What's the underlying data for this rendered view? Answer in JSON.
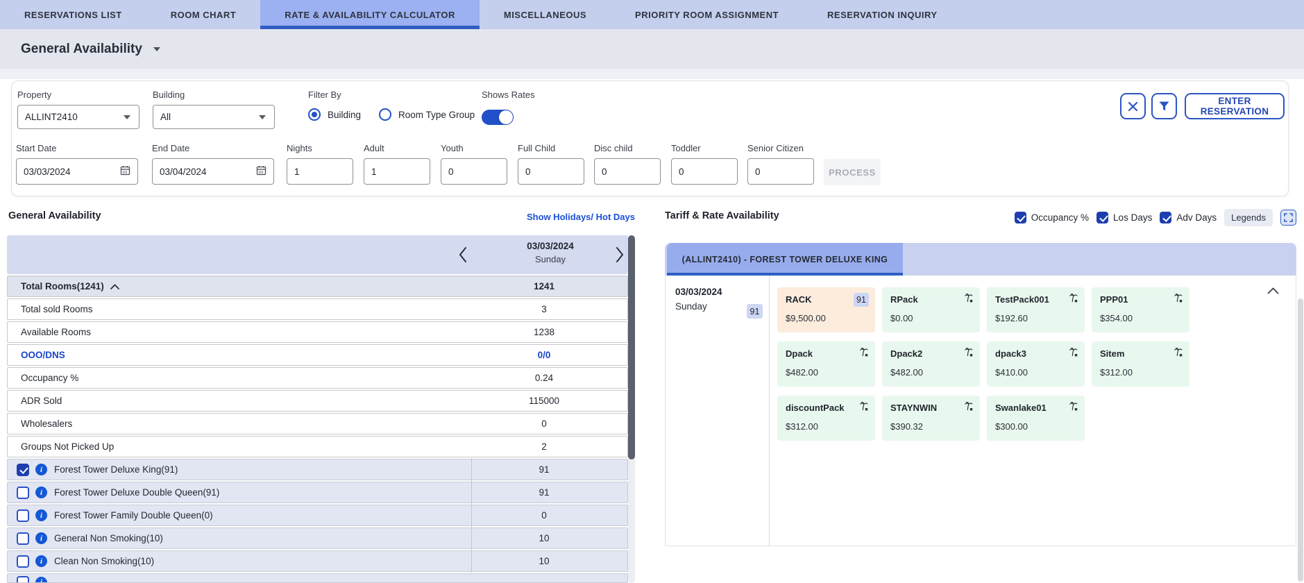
{
  "nav": {
    "tabs": [
      {
        "label": "RESERVATIONS LIST",
        "active": false
      },
      {
        "label": "ROOM CHART",
        "active": false
      },
      {
        "label": "RATE & AVAILABILITY CALCULATOR",
        "active": true
      },
      {
        "label": "MISCELLANEOUS",
        "active": false
      },
      {
        "label": "PRIORITY ROOM ASSIGNMENT",
        "active": false
      },
      {
        "label": "RESERVATION INQUIRY",
        "active": false
      }
    ]
  },
  "page": {
    "title": "General Availability"
  },
  "filters": {
    "property": {
      "label": "Property",
      "value": "ALLINT2410"
    },
    "building": {
      "label": "Building",
      "value": "All"
    },
    "filter_by": {
      "label": "Filter By",
      "options": [
        {
          "label": "Building",
          "selected": true
        },
        {
          "label": "Room Type Group",
          "selected": false
        }
      ]
    },
    "shows_rates": {
      "label": "Shows Rates",
      "on": true
    },
    "start_date": {
      "label": "Start Date",
      "value": "03/03/2024"
    },
    "end_date": {
      "label": "End Date",
      "value": "03/04/2024"
    },
    "nights": {
      "label": "Nights",
      "value": "1"
    },
    "adult": {
      "label": "Adult",
      "value": "1"
    },
    "youth": {
      "label": "Youth",
      "value": "0"
    },
    "full_child": {
      "label": "Full Child",
      "value": "0"
    },
    "disc_child": {
      "label": "Disc child",
      "value": "0"
    },
    "toddler": {
      "label": "Toddler",
      "value": "0"
    },
    "senior_citizen": {
      "label": "Senior Citizen",
      "value": "0"
    }
  },
  "actions": {
    "process": "PROCESS",
    "enter_reservation": "ENTER RESERVATION"
  },
  "general_availability": {
    "title": "General Availability",
    "holidays_link": "Show Holidays/ Hot Days",
    "date_nav": {
      "date": "03/03/2024",
      "day": "Sunday"
    },
    "metrics": [
      {
        "label": "Total Rooms(1241)",
        "value": "1241",
        "header_row": true
      },
      {
        "label": "Total sold Rooms",
        "value": "3"
      },
      {
        "label": "Available Rooms",
        "value": "1238"
      },
      {
        "label": "OOO/DNS",
        "value": "0/0",
        "accent": true
      },
      {
        "label": "Occupancy %",
        "value": "0.24"
      },
      {
        "label": "ADR Sold",
        "value": "115000"
      },
      {
        "label": "Wholesalers",
        "value": "0"
      },
      {
        "label": "Groups Not Picked Up",
        "value": "2"
      }
    ],
    "room_types": [
      {
        "label": "Forest Tower Deluxe King(91)",
        "value": "91",
        "checked": true
      },
      {
        "label": "Forest Tower Deluxe Double Queen(91)",
        "value": "91",
        "checked": false
      },
      {
        "label": "Forest Tower Family Double Queen(0)",
        "value": "0",
        "checked": false
      },
      {
        "label": "General Non Smoking(10)",
        "value": "10",
        "checked": false
      },
      {
        "label": "Clean Non Smoking(10)",
        "value": "10",
        "checked": false
      }
    ]
  },
  "tariff": {
    "title": "Tariff & Rate Availability",
    "options": [
      {
        "label": "Occupancy %",
        "checked": true
      },
      {
        "label": "Los Days",
        "checked": true
      },
      {
        "label": "Adv Days",
        "checked": true
      }
    ],
    "legends_label": "Legends",
    "tab": "(ALLINT2410) - FOREST TOWER DELUXE KING",
    "day_cell": {
      "date": "03/03/2024",
      "day": "Sunday",
      "occupancy": "91"
    },
    "rates": [
      {
        "name": "RACK",
        "price": "$9,500.00",
        "badge": "91",
        "highlight": true
      },
      {
        "name": "RPack",
        "price": "$0.00"
      },
      {
        "name": "TestPack001",
        "price": "$192.60"
      },
      {
        "name": "PPP01",
        "price": "$354.00"
      },
      {
        "name": "Dpack",
        "price": "$482.00"
      },
      {
        "name": "Dpack2",
        "price": "$482.00"
      },
      {
        "name": "dpack3",
        "price": "$410.00"
      },
      {
        "name": "Sitem",
        "price": "$312.00"
      },
      {
        "name": "discountPack",
        "price": "$312.00"
      },
      {
        "name": "STAYNWIN",
        "price": "$390.32"
      },
      {
        "name": "Swanlake01",
        "price": "$300.00"
      }
    ]
  },
  "colors": {
    "accent_blue": "#2150c8",
    "nav_bg": "#c4cfee",
    "nav_active_bg": "#9cb1f1",
    "nav_active_underline": "#2e5cc2",
    "table_header_bg": "#d4daf0",
    "room_row_bg": "#e2e6f3",
    "rack_card_bg": "#fcecdc",
    "rate_card_bg": "#e9f8ee",
    "occupancy_badge_bg": "#cdd6f3",
    "link_blue": "#1b4fd8"
  }
}
